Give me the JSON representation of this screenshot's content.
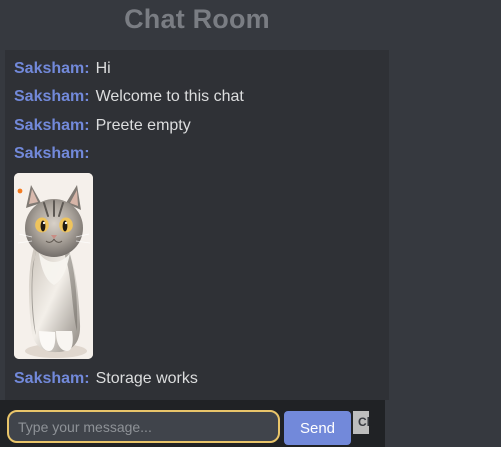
{
  "header": {
    "title": "Chat Room"
  },
  "messages": [
    {
      "sender": "Saksham:",
      "text": "Hi"
    },
    {
      "sender": "Saksham:",
      "text": "Welcome to this chat"
    },
    {
      "sender": "Saksham:",
      "text": "Preete empty"
    },
    {
      "sender": "Saksham:",
      "text": ""
    },
    {
      "sender": "Saksham:",
      "text": "Storage works"
    }
  ],
  "input": {
    "value": "",
    "placeholder": "Type your message..."
  },
  "buttons": {
    "send_label": "Send",
    "clear_label": "Cl"
  },
  "theme": {
    "background": "#36393f",
    "message_area": "#2f3136",
    "input_bar": "#202225",
    "sender_color": "#7289da",
    "input_border": "#e9c56a"
  }
}
